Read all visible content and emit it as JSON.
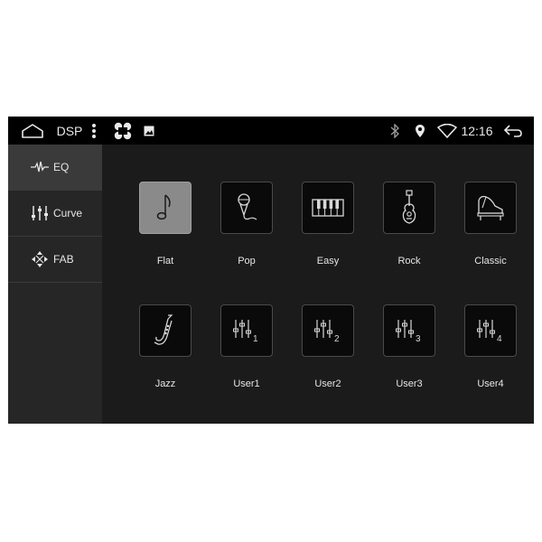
{
  "statusbar": {
    "title": "DSP",
    "time": "12:16",
    "icons": [
      "home-icon",
      "more-vert-icon",
      "apps-icon",
      "image-icon",
      "bluetooth-icon",
      "location-icon",
      "wifi-icon",
      "back-icon"
    ]
  },
  "sidebar": {
    "items": [
      {
        "label": "EQ",
        "icon": "eq-wave-icon",
        "active": true
      },
      {
        "label": "Curve",
        "icon": "curve-sliders-icon",
        "active": false
      },
      {
        "label": "FAB",
        "icon": "fab-arrows-icon",
        "active": false
      }
    ]
  },
  "presets": [
    {
      "label": "Flat",
      "icon": "music-note-icon",
      "selected": true
    },
    {
      "label": "Pop",
      "icon": "microphone-icon",
      "selected": false
    },
    {
      "label": "Easy",
      "icon": "keyboard-icon",
      "selected": false
    },
    {
      "label": "Rock",
      "icon": "guitar-icon",
      "selected": false
    },
    {
      "label": "Classic",
      "icon": "piano-icon",
      "selected": false
    },
    {
      "label": "Jazz",
      "icon": "saxophone-icon",
      "selected": false
    },
    {
      "label": "User1",
      "icon": "user-eq-icon",
      "badge": "1",
      "selected": false
    },
    {
      "label": "User2",
      "icon": "user-eq-icon",
      "badge": "2",
      "selected": false
    },
    {
      "label": "User3",
      "icon": "user-eq-icon",
      "badge": "3",
      "selected": false
    },
    {
      "label": "User4",
      "icon": "user-eq-icon",
      "badge": "4",
      "selected": false
    }
  ],
  "colors": {
    "screen_bg": "#1e1e1e",
    "statusbar_bg": "#000000",
    "tile_bg": "#0a0a0a",
    "tile_selected": "#8a8a8a",
    "text": "#e6e6e6"
  }
}
